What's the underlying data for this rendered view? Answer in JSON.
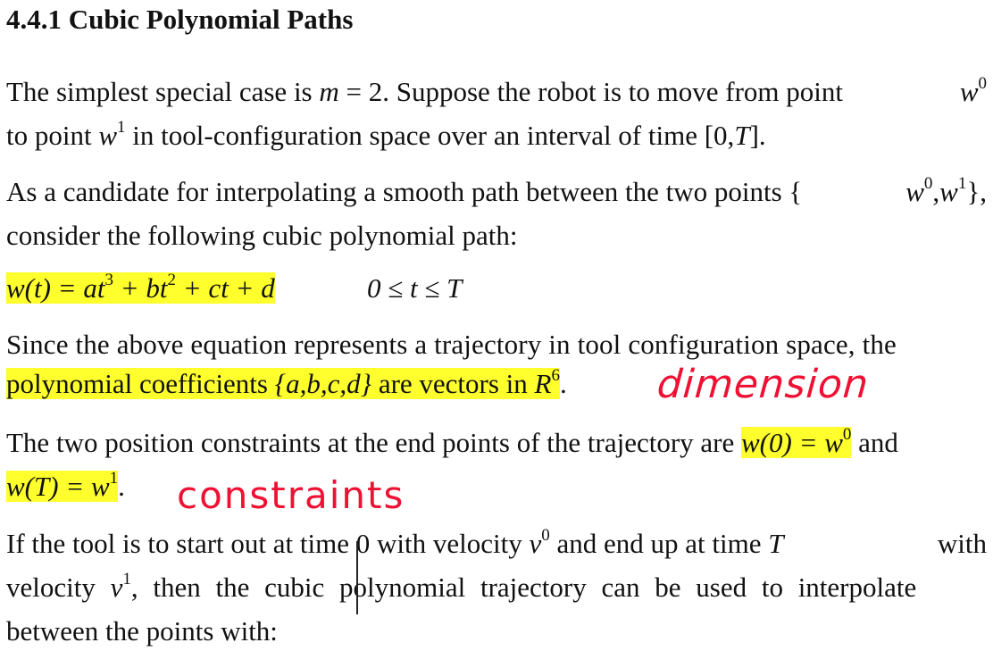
{
  "heading": "4.4.1 Cubic Polynomial Paths",
  "p1": {
    "line1": {
      "a": "The simplest special case is ",
      "m": "m",
      "eq": " = 2",
      "b": ". Suppose the robot is to move from point ",
      "w": "w",
      "sup": "0"
    },
    "line2": {
      "a": "to point ",
      "w": "w",
      "sup": "1",
      "b": " in tool-configuration space over an interval of time [0,",
      "T": "T",
      "c": "]."
    }
  },
  "p2": {
    "line1": {
      "a": "As a candidate for interpolating a smooth path between the two points {",
      "w0": "w",
      "sup0": "0",
      "comma": ",",
      "w1": "w",
      "sup1": "1",
      "end": "},"
    },
    "line2": "consider the following cubic polynomial path:"
  },
  "equation": {
    "lhs": "w(t) = at",
    "sup3": "3",
    "mid1": " + bt",
    "sup2": "2",
    "rest": " + ct + d",
    "range": "0 ≤ t ≤ T"
  },
  "p3": {
    "line1": "Since the above equation represents a trajectory in tool configuration space, the",
    "line2": {
      "a": "polynomial coefficients ",
      "set": "{a,b,c,d}",
      "b": " are vectors in ",
      "R": "R",
      "sup": "6",
      "end": "."
    }
  },
  "p4": {
    "line1": {
      "a": "The two position constraints at the end points of the trajectory are ",
      "eq": "w(0) = w",
      "sup": "0",
      "b": " and"
    },
    "line2": {
      "eq": "w(T) = w",
      "sup": "1",
      "end": "."
    }
  },
  "p5": {
    "line1": {
      "a": "If the tool is to start out at time 0 with velocity ",
      "v": "v",
      "sup": "0",
      "b": " and end up at time ",
      "T": "T",
      "c": " with"
    },
    "line2": {
      "a": "velocity ",
      "v": "v",
      "sup": "1",
      "b": ", then the cubic polynomial trajectory can be used to interpolate"
    },
    "line3": "between the points with:"
  },
  "annotations": {
    "dimension": "dimension",
    "constraints": "constraints",
    "ink_color": "#ee1133",
    "highlight_color": "#ffff2e"
  }
}
